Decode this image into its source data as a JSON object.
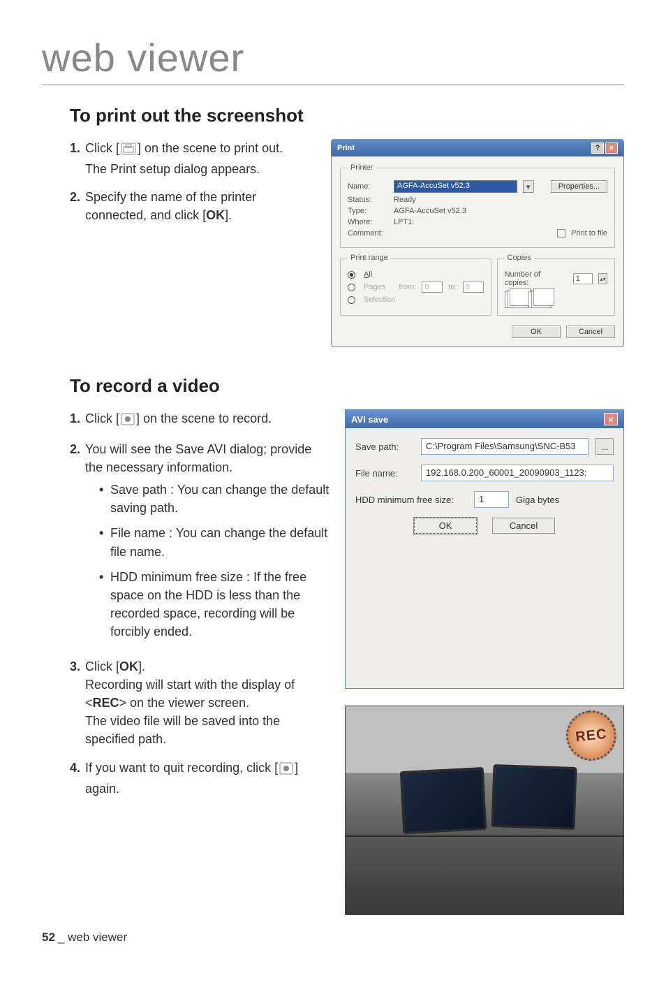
{
  "page": {
    "header": "web viewer",
    "footer_page": "52",
    "footer_label": "_ web viewer"
  },
  "sec_print": {
    "title": "To print out the screenshot",
    "steps": {
      "s1_num": "1.",
      "s1_a": "Click [",
      "s1_b": "] on the scene to print out.",
      "s1_c": "The Print setup dialog appears.",
      "s2_num": "2.",
      "s2_a": "Specify the name of the printer connected, and click [",
      "s2_ok": "OK",
      "s2_b": "]."
    }
  },
  "print_dlg": {
    "title": "Print",
    "grp_printer": "Printer",
    "name_lbl": "Name:",
    "name_val": "AGFA-AccuSet v52.3",
    "props": "Properties...",
    "status_lbl": "Status:",
    "status_val": "Ready",
    "type_lbl": "Type:",
    "type_val": "AGFA-AccuSet v52.3",
    "where_lbl": "Where:",
    "where_val": "LPT1:",
    "comment_lbl": "Comment:",
    "print_to_file": "Print to file",
    "grp_range": "Print range",
    "r_all": "All",
    "r_pages": "Pages",
    "from_lbl": "from:",
    "from_val": "0",
    "to_lbl": "to:",
    "to_val": "0",
    "r_sel": "Selection",
    "grp_copies": "Copies",
    "num_copies_lbl": "Number of copies:",
    "num_copies_val": "1",
    "ok": "OK",
    "cancel": "Cancel"
  },
  "sec_rec": {
    "title": "To record a video",
    "s1_num": "1.",
    "s1_a": "Click [",
    "s1_b": "] on the scene to record.",
    "s2_num": "2.",
    "s2_a": "You will see the Save AVI dialog; provide the necessary information.",
    "b_save": "Save path : You can change the default saving path.",
    "b_file": "File name : You can change the default file name.",
    "b_hdd": "HDD minimum free size : If the free space on the HDD is less than the recorded space, recording will be forcibly ended.",
    "s3_num": "3.",
    "s3_a": "Click [",
    "s3_ok": "OK",
    "s3_b": "].",
    "s3_c1": "Recording will start with the display of <",
    "s3_rec": "REC",
    "s3_c2": "> on the viewer screen.",
    "s3_d": "The video file will be saved into the specified path.",
    "s4_num": "4.",
    "s4_a": "If you want to quit recording, click [",
    "s4_b": "] again."
  },
  "avi": {
    "title": "AVI save",
    "savepath_lbl": "Save path:",
    "savepath_val": "C:\\Program Files\\Samsung\\SNC-B53",
    "filename_lbl": "File name:",
    "filename_val": "192.168.0.200_60001_20090903_1123:",
    "hdd_lbl": "HDD minimum free size:",
    "hdd_val": "1",
    "hdd_unit": "Giga bytes",
    "ok": "OK",
    "cancel": "Cancel",
    "browse": "..."
  },
  "rec_badge": "REC"
}
